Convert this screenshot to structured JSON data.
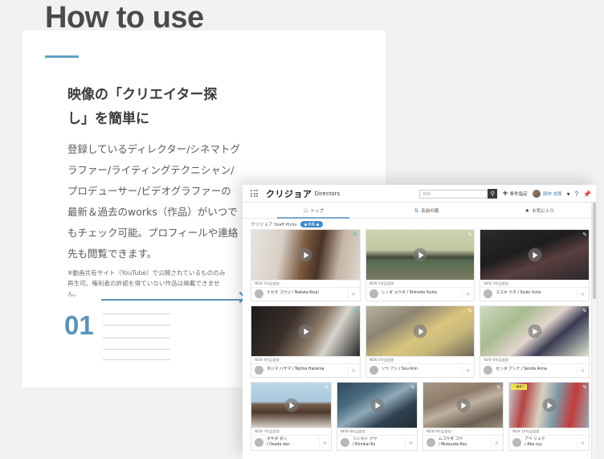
{
  "editorial": {
    "section_title": "How to use",
    "lede": "映像の「クリエイター探し」を簡単に",
    "body": "登録しているディレクター/シネマトグラファー/ライティングテクニシャン/プロデューサー/ビデオグラファーの最新＆過去のworks（作品）がいつでもチェック可能。プロフィールや連絡先も閲覧できます。",
    "fine_print": "※動画共有サイト（YouTube）で公開されているもののみ再生可。権利者の許諾を得ていない作品は掲載できません。",
    "step_number": "01",
    "accent_color": "#5b93b8"
  },
  "browser": {
    "topbar": {
      "grid_icon": "apps-grid-icon",
      "brand": "クリジョア",
      "brand_sub": "Directors",
      "search_placeholder": "検索",
      "search_value": "",
      "search_icon": "magnifier-icon",
      "condition_label": "条件指定",
      "condition_icon": "plus-icon",
      "user_name": "田中 太郎",
      "chevron_icon": "chevron-down-icon",
      "help_icon": "question-mark-icon",
      "pin_icon": "pin-icon"
    },
    "tabs": [
      {
        "label": "トップ",
        "icon": "home-icon",
        "active": true
      },
      {
        "label": "名前の順",
        "icon": "sort-icon",
        "active": false
      },
      {
        "label": "お気に入り",
        "icon": "star-icon",
        "active": false
      }
    ],
    "staff_picks": {
      "label": "クリジョア Staff Picks",
      "badge": "新着",
      "badge_color": "#3f8ccb"
    },
    "cards": [
      [
        {
          "meta": "NEW 1作品追加",
          "name_kana": "ナカタ コウジ",
          "name_roman": "/ Nakata Kouji",
          "thumb": "t-hair",
          "corner": "teal",
          "favorited": false
        },
        {
          "meta": "NEW 2作品追加",
          "name_kana": "シノダ ユウタ",
          "name_roman": "/ Shinoda Yuuta",
          "thumb": "t-lake",
          "corner": "plain",
          "favorited": false
        },
        {
          "meta": "NEW 3作品追加",
          "name_kana": "スズキ ウタ",
          "name_roman": "/ Szuki Uuta",
          "thumb": "t-car",
          "corner": "plain",
          "favorited": false
        }
      ],
      [
        {
          "meta": "NEW 4作品追加",
          "name_kana": "タジマ ハザマ",
          "name_roman": "/ Tajima Hazama",
          "thumb": "t-bass",
          "corner": "teal",
          "favorited": false
        },
        {
          "meta": "NEW 5作品追加",
          "name_kana": "ソウ アン",
          "name_roman": "/ Sou Ann",
          "thumb": "t-fish",
          "corner": "plain",
          "favorited": false
        },
        {
          "meta": "NEW 6作品追加",
          "name_kana": "センダ アンナ",
          "name_roman": "/ Senda Anna",
          "thumb": "t-child",
          "corner": "plain",
          "favorited": false
        }
      ],
      [
        {
          "meta": "NEW 7作品追加",
          "name_kana": "オサダ ダン",
          "name_roman": "/ Osada dan",
          "thumb": "t-cup",
          "corner": "plain",
          "favorited": false
        },
        {
          "meta": "NEW 8作品追加",
          "name_kana": "リンカイ クウ",
          "name_roman": "/ Rinnkai Ku",
          "thumb": "t-fact",
          "corner": "plain",
          "favorited": false
        },
        {
          "meta": "NEW 9作品追加",
          "name_kana": "ムコウダ コウ",
          "name_roman": "/ Mukouda Kou",
          "thumb": "t-road",
          "corner": "plain",
          "favorited": false
        },
        {
          "meta": "NEW 10作品追加",
          "name_kana": "アベ リュク",
          "name_roman": "/ Abe ryu",
          "thumb": "t-city",
          "corner": "plain",
          "favorited": false,
          "tag": "一番乗り"
        }
      ]
    ]
  }
}
